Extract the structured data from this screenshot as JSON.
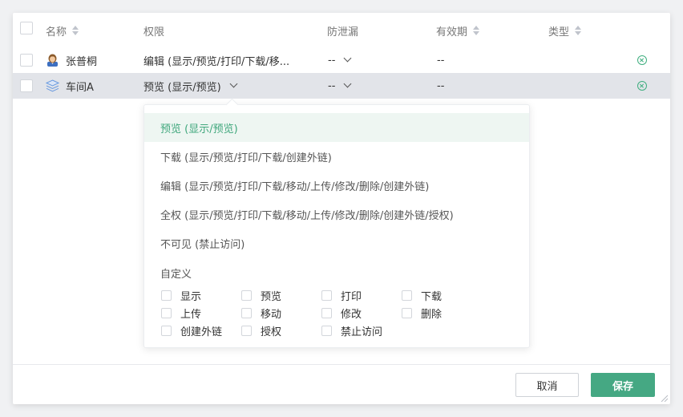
{
  "table": {
    "headers": {
      "name": "名称",
      "permission": "权限",
      "leak_prevention": "防泄漏",
      "validity": "有效期",
      "type": "类型"
    },
    "rows": [
      {
        "icon": "user-avatar-icon",
        "name": "张普桐",
        "permission": "编辑 (显示/预览/打印/下载/移...",
        "leak_prevention": "--",
        "validity": "--"
      },
      {
        "icon": "layers-icon",
        "name": "车间A",
        "permission": "预览 (显示/预览)",
        "leak_prevention": "--",
        "validity": "--"
      }
    ]
  },
  "dropdown": {
    "options": [
      "预览 (显示/预览)",
      "下载 (显示/预览/打印/下载/创建外链)",
      "编辑 (显示/预览/打印/下载/移动/上传/修改/删除/创建外链)",
      "全权 (显示/预览/打印/下载/移动/上传/修改/删除/创建外链/授权)",
      "不可见 (禁止访问)"
    ],
    "selected_index": 0,
    "custom_label": "自定义",
    "custom_perms": [
      "显示",
      "预览",
      "打印",
      "下载",
      "上传",
      "移动",
      "修改",
      "删除",
      "创建外链",
      "授权",
      "禁止访问"
    ]
  },
  "footer": {
    "cancel_label": "取消",
    "save_label": "保存"
  },
  "colors": {
    "accent": "#45a883",
    "selected_row_bg": "#e2e4e9",
    "selected_option_bg": "#eef6f2"
  }
}
